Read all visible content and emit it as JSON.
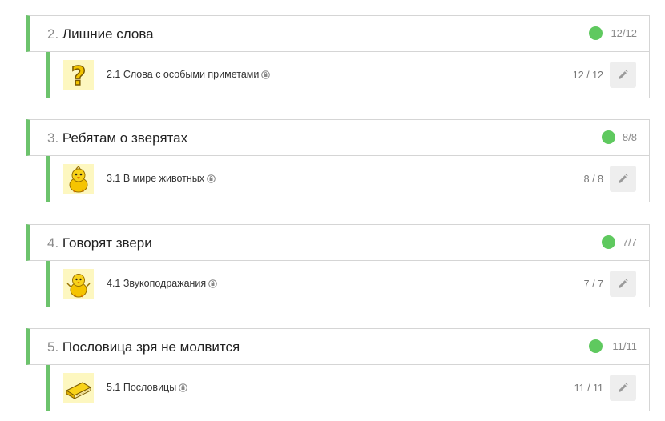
{
  "accent_color": "#6cc36c",
  "status_color": "#5fc95f",
  "modules": [
    {
      "number": "2.",
      "title": "Лишние слова",
      "count": "12/12",
      "lesson": {
        "title": "2.1 Слова с особыми приметами",
        "count": "12 / 12",
        "thumb_icon": "question-mark-icon"
      }
    },
    {
      "number": "3.",
      "title": "Ребятам о зверятах",
      "count": "8/8",
      "lesson": {
        "title": "3.1 В мире животных",
        "count": "8 / 8",
        "thumb_icon": "chick-icon"
      }
    },
    {
      "number": "4.",
      "title": "Говорят звери",
      "count": "7/7",
      "lesson": {
        "title": "4.1 Звукоподражания",
        "count": "7 / 7",
        "thumb_icon": "chick-icon"
      }
    },
    {
      "number": "5.",
      "title": "Пословица зря не молвится",
      "count": "11/11",
      "lesson": {
        "title": "5.1 Пословицы",
        "count": "11 / 11",
        "thumb_icon": "book-icon"
      }
    }
  ]
}
